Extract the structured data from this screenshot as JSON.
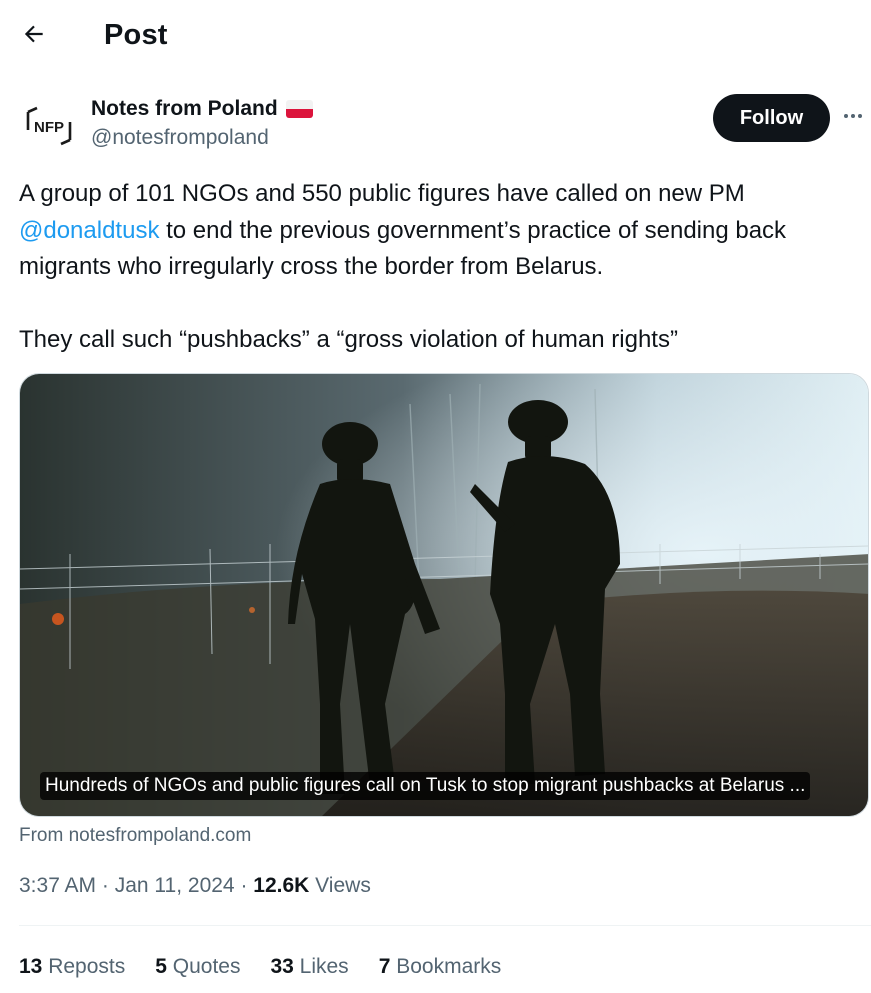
{
  "header": {
    "title": "Post",
    "back_icon": "arrow-left-icon"
  },
  "author": {
    "display_name": "Notes from Poland",
    "flag": "poland-flag-emoji",
    "handle": "@notesfrompoland",
    "avatar_text": "NFP",
    "follow_label": "Follow",
    "more_icon": "more-horizontal-icon"
  },
  "post": {
    "text_before_mention": "A group of 101 NGOs and 550 public figures have called on new PM ",
    "mention": "@donaldtusk",
    "text_after_mention": " to end the previous government’s practice of sending back migrants who irregularly cross the border from Belarus.",
    "paragraph_2": "They call such “pushbacks” a “gross violation of human rights”"
  },
  "card": {
    "caption": "Hundreds of NGOs and public figures call on Tusk to stop migrant pushbacks at Belarus ...",
    "source": "From notesfrompoland.com"
  },
  "meta": {
    "time": "3:37 AM",
    "separator": " · ",
    "date": "Jan 11, 2024",
    "views_count": "12.6K",
    "views_label": " Views"
  },
  "stats": {
    "reposts_count": "13",
    "reposts_label": " Reposts",
    "quotes_count": "5",
    "quotes_label": " Quotes",
    "likes_count": "33",
    "likes_label": " Likes",
    "bookmarks_count": "7",
    "bookmarks_label": " Bookmarks"
  },
  "colors": {
    "accent": "#1d9bf0",
    "text": "#0f1419",
    "secondary": "#536471",
    "follow_bg": "#0f1419"
  }
}
